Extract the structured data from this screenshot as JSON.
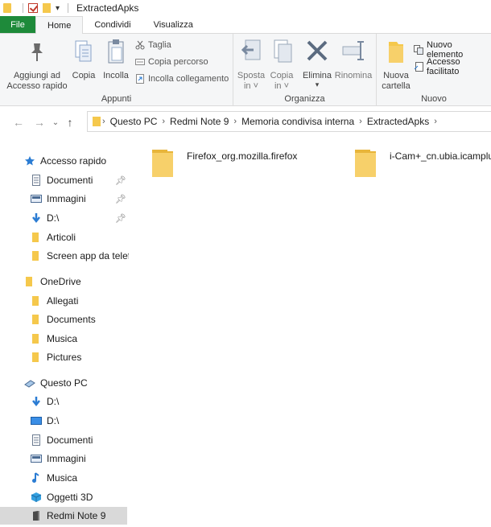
{
  "window": {
    "title": "ExtractedApks"
  },
  "tabs": [
    "File",
    "Home",
    "Condividi",
    "Visualizza"
  ],
  "ribbon": {
    "groups": {
      "appunti": "Appunti",
      "organizza": "Organizza",
      "nuovo": "Nuovo"
    },
    "buttons": {
      "aggiungi": "Aggiungi ad\nAccesso rapido",
      "copia": "Copia",
      "incolla": "Incolla",
      "taglia": "Taglia",
      "copia_percorso": "Copia percorso",
      "incolla_collegamento": "Incolla collegamento",
      "sposta": "Sposta\nin ˅",
      "copia_in": "Copia\nin ˅",
      "elimina": "Elimina",
      "rinomina": "Rinomina",
      "nuova_cartella": "Nuova\ncartella",
      "nuovo_elemento": "Nuovo elemento",
      "accesso_facilitato": "Accesso facilitato"
    }
  },
  "address": {
    "crumbs": [
      "Questo PC",
      "Redmi Note 9",
      "Memoria condivisa interna",
      "ExtractedApks"
    ]
  },
  "sidebar": {
    "items": [
      {
        "label": "Accesso rapido",
        "icon": "star-icon"
      },
      {
        "label": "Documenti",
        "icon": "document-icon",
        "pinned": true
      },
      {
        "label": "Immagini",
        "icon": "image-icon",
        "pinned": true
      },
      {
        "label": "D:\\",
        "icon": "download-icon",
        "pinned": true
      },
      {
        "label": "Articoli",
        "icon": "folder-icon"
      },
      {
        "label": "Screen app da telef",
        "icon": "folder-icon"
      },
      {
        "label": "OneDrive",
        "icon": "folder-icon"
      },
      {
        "label": "Allegati",
        "icon": "folder-icon"
      },
      {
        "label": "Documents",
        "icon": "folder-icon"
      },
      {
        "label": "Musica",
        "icon": "folder-icon"
      },
      {
        "label": "Pictures",
        "icon": "folder-icon"
      },
      {
        "label": "Questo PC",
        "icon": "computer-icon"
      },
      {
        "label": "D:\\",
        "icon": "download-icon"
      },
      {
        "label": "D:\\",
        "icon": "desktop-icon"
      },
      {
        "label": "Documenti",
        "icon": "document-icon"
      },
      {
        "label": "Immagini",
        "icon": "image-icon"
      },
      {
        "label": "Musica",
        "icon": "music-icon"
      },
      {
        "label": "Oggetti 3D",
        "icon": "cube-icon"
      },
      {
        "label": "Redmi Note 9",
        "icon": "phone-icon",
        "selected": true
      }
    ]
  },
  "content": {
    "items": [
      {
        "label": "Firefox_org.mozilla.firefox"
      },
      {
        "label": "i-Cam+_cn.ubia.icamplus"
      }
    ]
  },
  "colors": {
    "file_tab": "#1e8a3a",
    "folder": "#f5c84c",
    "accent_blue": "#2b7cd3"
  }
}
